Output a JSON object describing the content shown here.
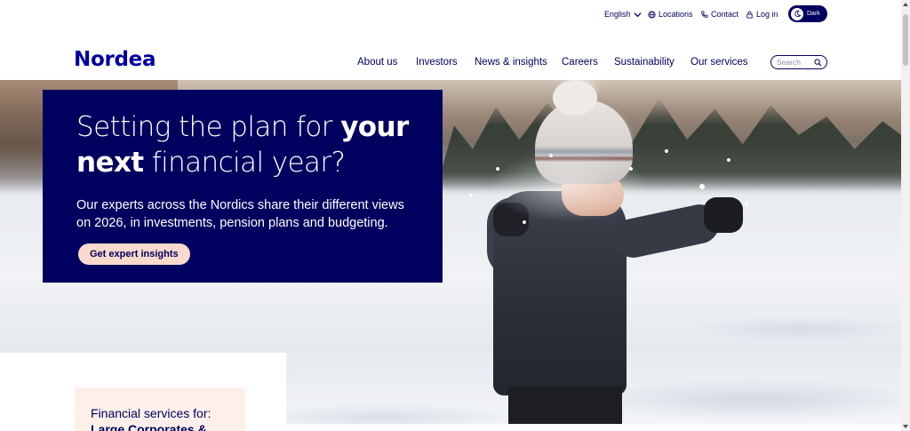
{
  "utility": {
    "language": "English",
    "locations": "Locations",
    "contact": "Contact",
    "login": "Log in",
    "dark_toggle": "Dark"
  },
  "header": {
    "logo": "Nordea",
    "nav": [
      "About us",
      "Investors",
      "News & insights",
      "Careers",
      "Sustainability",
      "Our services"
    ],
    "search_placeholder": "Search"
  },
  "hero": {
    "title_part1": "Setting the plan for ",
    "title_bold1": "your",
    "title_bold2": "next",
    "title_part2": " financial year?",
    "subtitle": "Our experts across the Nordics share their different views on 2026, in investments, pension plans and budgeting.",
    "cta": "Get expert insights"
  },
  "services_card": {
    "line1": "Financial services for:",
    "line2": "Large Corporates &"
  },
  "colors": {
    "brand_navy": "#00005e",
    "logo_blue": "#0000a0",
    "cta_peach": "#fbd9cd",
    "card_peach": "#fdf0ea"
  }
}
